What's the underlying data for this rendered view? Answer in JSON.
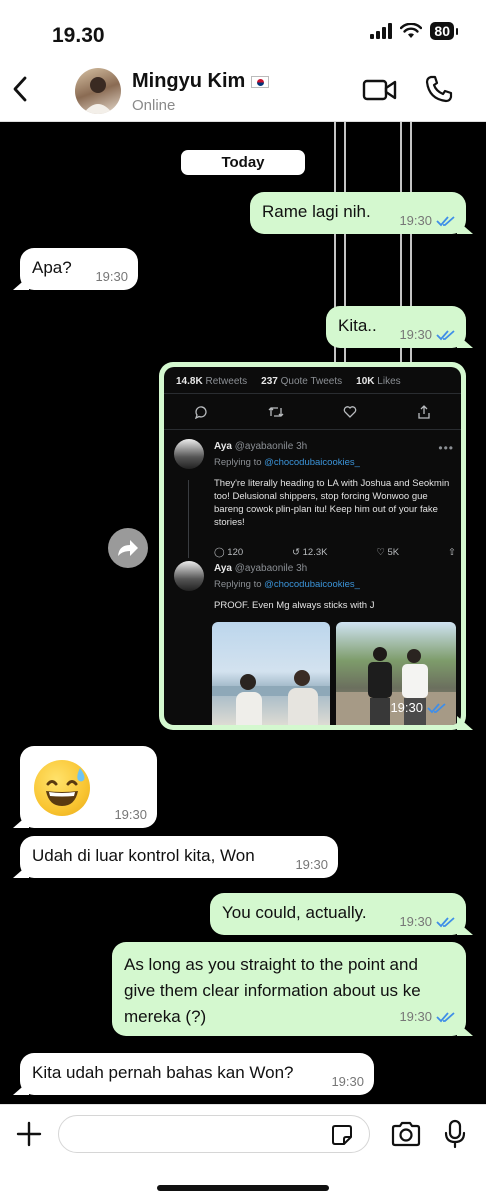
{
  "status_bar": {
    "time": "19.30",
    "battery": "80"
  },
  "header": {
    "name": "Mingyu Kim",
    "status": "Online"
  },
  "chat": {
    "date_chip": "Today",
    "messages": [
      {
        "text": "Rame lagi nih.",
        "time": "19:30"
      },
      {
        "text": "Apa?",
        "time": "19:30"
      },
      {
        "text": "Kita..",
        "time": "19:30"
      },
      {
        "text": "",
        "time": "19:30"
      },
      {
        "text": "",
        "time": "19:30"
      },
      {
        "text": "Udah di luar kontrol kita, Won",
        "time": "19:30"
      },
      {
        "text": "You could, actually.",
        "time": "19:30"
      },
      {
        "text": "As long as you straight to the point and give them clear information about us ke mereka (?)",
        "time": "19:30"
      },
      {
        "text": "Kita udah pernah bahas kan Won?",
        "time": "19:30"
      }
    ]
  },
  "tweet": {
    "stats": {
      "retweets": "14.8K",
      "retweets_label": "Retweets",
      "quotes": "237",
      "quotes_label": "Quote Tweets",
      "likes": "10K",
      "likes_label": "Likes"
    },
    "reply1": {
      "name": "Aya",
      "handle": "@ayabaonile",
      "age": "3h",
      "replying_prefix": "Replying to",
      "replying_to": "@chocodubaicookies_",
      "text": "They're literally heading to LA with Joshua and Seokmin too! Delusional shippers, stop forcing Wonwoo gue bareng cowok plin-plan itu! Keep him out of your fake stories!",
      "replies": "120",
      "retweets": "12.3K",
      "likes": "5K"
    },
    "reply2": {
      "name": "Aya",
      "handle": "@ayabaonile",
      "age": "3h",
      "replying_prefix": "Replying to",
      "replying_to": "@chocodubaicookies_",
      "text": "PROOF. Even Mg always sticks with J"
    }
  },
  "colors": {
    "outgoing_bubble": "#d4f8cf",
    "incoming_bubble": "#ffffff",
    "read_ticks": "#3f8ee8",
    "link_blue": "#3b94d9"
  },
  "icons": [
    "back-chevron-icon",
    "video-call-icon",
    "phone-icon",
    "share-forward-icon",
    "plus-icon",
    "sticker-icon",
    "camera-icon",
    "mic-icon",
    "double-check-icon"
  ]
}
